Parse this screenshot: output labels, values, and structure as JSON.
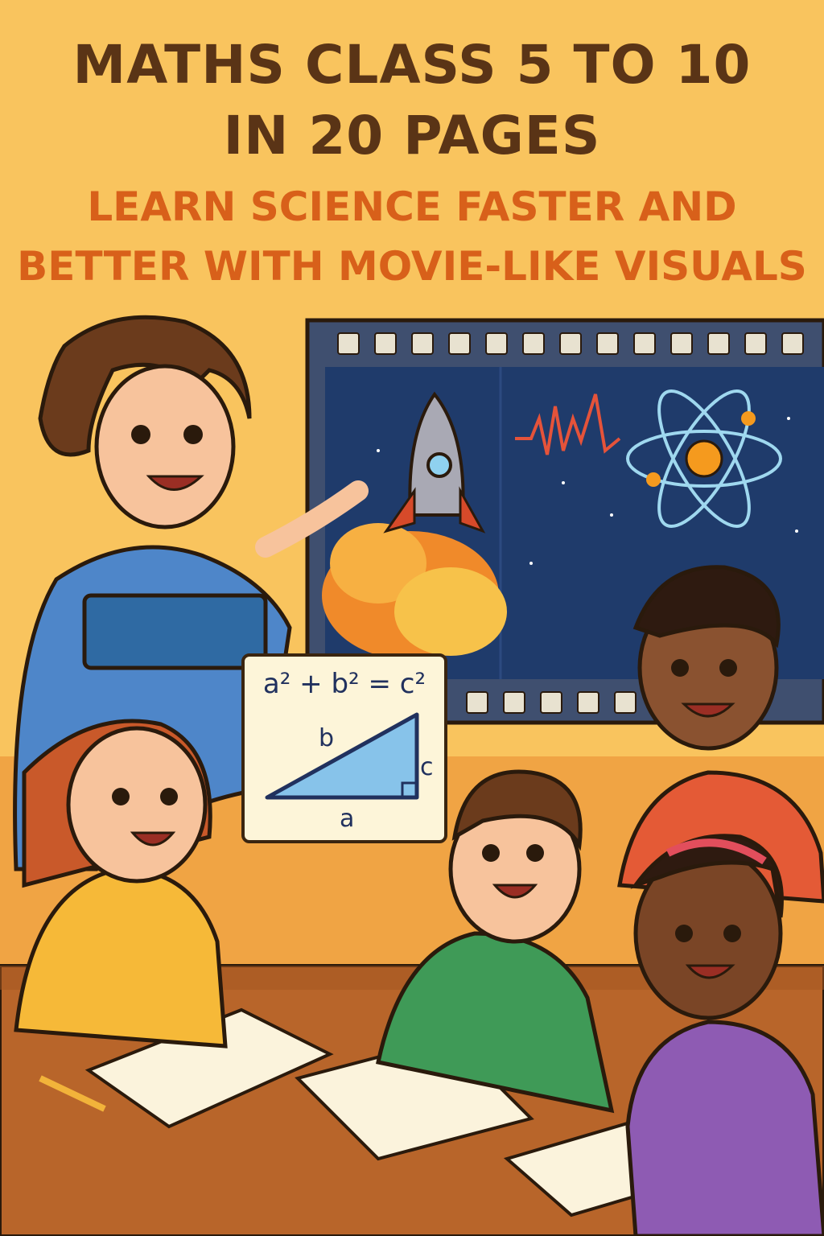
{
  "cover": {
    "title_line1": "MATHS CLASS 5 TO 10",
    "title_line2": "IN 20 PAGES",
    "subtitle_line1": "LEARN SCIENCE FASTER AND",
    "subtitle_line2": "BETTER WITH MOVIE-LIKE VISUALS"
  },
  "board": {
    "formula": "a² + b² = c²",
    "side_b": "b",
    "side_c": "c",
    "side_a": "a"
  },
  "colors": {
    "background": "#f9c45e",
    "title": "#5a3416",
    "subtitle": "#d8601a",
    "screen": "#1f3b6b"
  }
}
